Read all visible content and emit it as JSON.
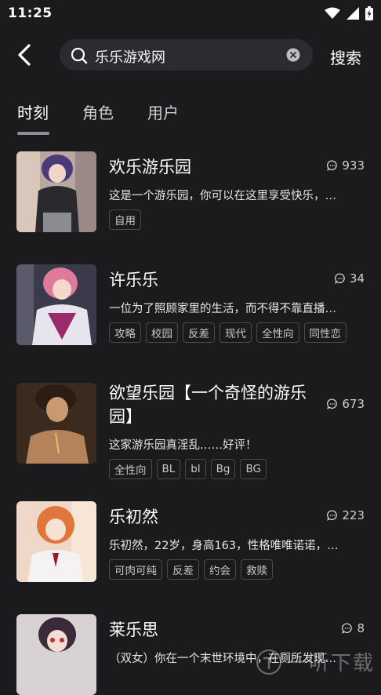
{
  "status": {
    "time": "11:25"
  },
  "search": {
    "query": "乐乐游戏网",
    "button": "搜索"
  },
  "tabs": [
    {
      "label": "时刻",
      "active": true
    },
    {
      "label": "角色",
      "active": false
    },
    {
      "label": "用户",
      "active": false
    }
  ],
  "results": [
    {
      "title": "欢乐游乐园",
      "count": "933",
      "desc": "这是一个游乐园，你可以在这里享受快乐，…",
      "tags": [
        "自用"
      ]
    },
    {
      "title": "许乐乐",
      "count": "34",
      "desc": "一位为了照顾家里的生活，而不得不靠直播…",
      "tags": [
        "攻略",
        "校园",
        "反差",
        "现代",
        "全性向",
        "同性恋"
      ]
    },
    {
      "title": "欲望乐园【一个奇怪的游乐园】",
      "title_line1": "欲望乐园【一个奇怪的游乐",
      "title_line2": "园】",
      "count": "673",
      "desc": "这家游乐园真淫乱……好评！",
      "tags": [
        "全性向",
        "BL",
        "bl",
        "Bg",
        "BG"
      ]
    },
    {
      "title": "乐初然",
      "count": "223",
      "desc": "乐初然，22岁，身高163，性格唯唯诺诺，…",
      "tags": [
        "可肉可纯",
        "反差",
        "约会",
        "救赎"
      ]
    },
    {
      "title": "莱乐思",
      "count": "8",
      "desc": "（双女）你在一个末世环境中，在厕所发现…",
      "tags": []
    }
  ],
  "watermark": {
    "text": "一听下载"
  },
  "colors": {
    "background": "#1b1b1d",
    "search_bg": "#2c2c30",
    "tag_border": "#4a4a4e"
  }
}
